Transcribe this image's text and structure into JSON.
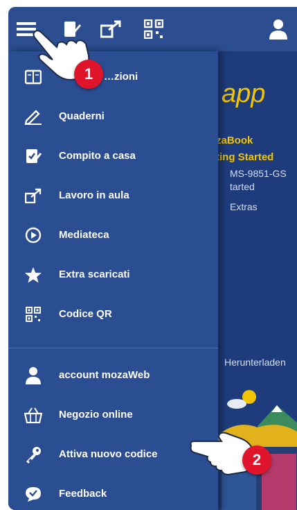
{
  "menu": {
    "items": [
      {
        "label": "…zioni",
        "icon": "book-icon"
      },
      {
        "label": "Quaderni",
        "icon": "pencil-icon"
      },
      {
        "label": "Compito a casa",
        "icon": "homework-icon"
      },
      {
        "label": "Lavoro in aula",
        "icon": "classroom-icon"
      },
      {
        "label": "Mediateca",
        "icon": "media-icon"
      },
      {
        "label": "Extra scaricati",
        "icon": "star-icon"
      },
      {
        "label": "Codice QR",
        "icon": "qr-icon"
      }
    ],
    "account_items": [
      {
        "label": "account mozaWeb",
        "icon": "user-icon"
      },
      {
        "label": "Negozio online",
        "icon": "basket-icon"
      },
      {
        "label": "Attiva nuovo codice",
        "icon": "key-icon"
      },
      {
        "label": "Feedback",
        "icon": "feedback-icon"
      }
    ]
  },
  "background": {
    "title_fragment": "app",
    "line1": "zaBook",
    "line2": "ting Started",
    "line3": "MS-9851-GS",
    "line4": "tarted",
    "line5": "Extras",
    "download": "Herunterladen"
  },
  "annotations": {
    "step1": "1",
    "step2": "2"
  },
  "colors": {
    "drawer": "#2b4d92",
    "topbar": "#2c4d8f",
    "accent": "#f2c300",
    "badge": "#e0142b"
  }
}
